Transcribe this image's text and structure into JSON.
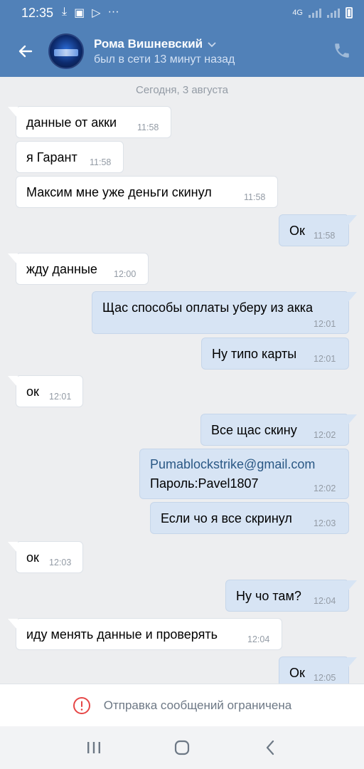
{
  "status_bar": {
    "time": "12:35",
    "network": "4G"
  },
  "header": {
    "name": "Рома Вишневский",
    "last_seen": "был в сети 13 минут назад"
  },
  "date_label": "Сегодня, 3 августа",
  "messages": [
    {
      "text": "данные от акки",
      "time": "11:58"
    },
    {
      "text": "я Гарант",
      "time": "11:58"
    },
    {
      "text": "Максим мне уже деньги скинул",
      "time": "11:58"
    },
    {
      "text": "Ок",
      "time": "11:58"
    },
    {
      "text": "жду данные",
      "time": "12:00"
    },
    {
      "text": "Щас способы оплаты уберу из акка",
      "time": "12:01"
    },
    {
      "text": "Ну типо карты",
      "time": "12:01"
    },
    {
      "text": "ок",
      "time": "12:01"
    },
    {
      "text": "Все щас скину",
      "time": "12:02"
    },
    {
      "link": "Pumablockstrike@gmail.com",
      "text": "Пароль:Pavel1807",
      "time": "12:02"
    },
    {
      "text": "Если чо я все скринул",
      "time": "12:03"
    },
    {
      "text": "ок",
      "time": "12:03"
    },
    {
      "text": "Ну чо там?",
      "time": "12:04"
    },
    {
      "text": "иду менять данные и проверять",
      "time": "12:04"
    },
    {
      "text": "Ок",
      "time": "12:05"
    }
  ],
  "restriction_text": "Отправка сообщений ограничена",
  "colors": {
    "header_bg": "#5181b8",
    "incoming_bg": "#ffffff",
    "outgoing_bg": "#d7e4f4",
    "link": "#2a5885"
  }
}
